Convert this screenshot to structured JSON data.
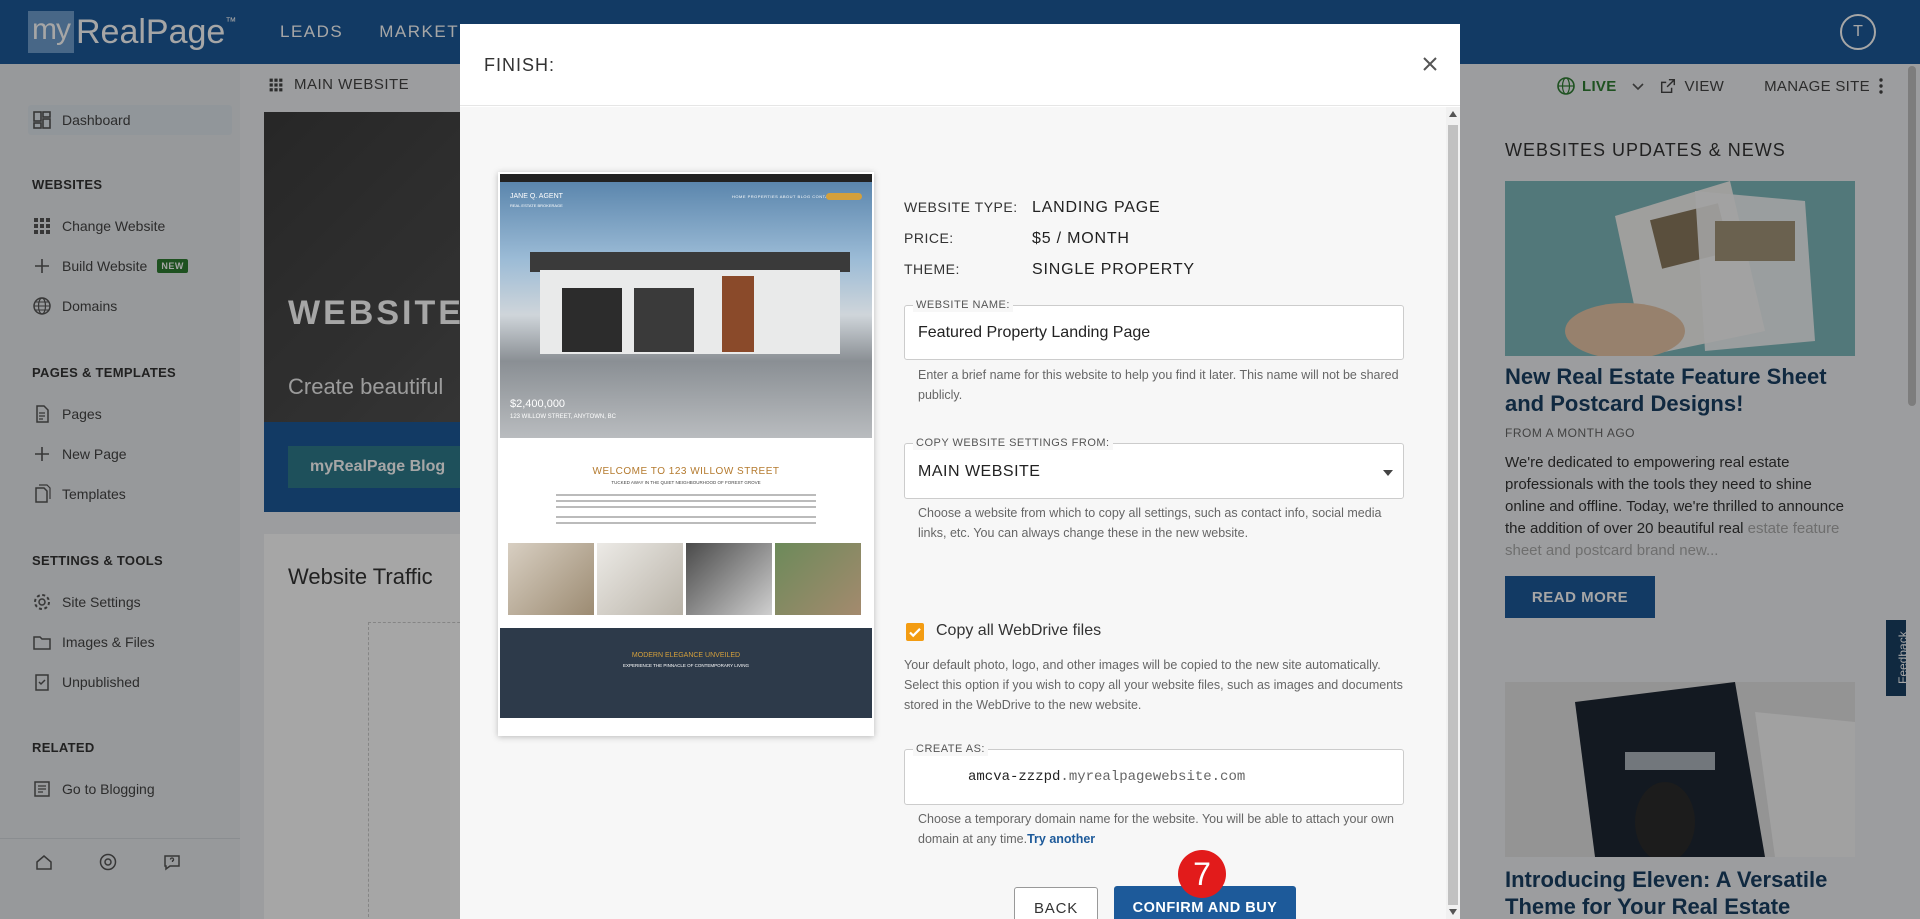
{
  "app": {
    "logo_my": "my",
    "logo_rest": "RealPage",
    "logo_tm": "™",
    "nav": [
      "LEADS",
      "MARKETING"
    ],
    "avatar_initial": "T"
  },
  "sidebar": {
    "dashboard": "Dashboard",
    "sections": {
      "websites": "WEBSITES",
      "pages": "PAGES & TEMPLATES",
      "settings": "SETTINGS & TOOLS",
      "related": "RELATED"
    },
    "items": {
      "change_website": "Change Website",
      "build_website": "Build Website",
      "build_badge": "NEW",
      "domains": "Domains",
      "pages": "Pages",
      "new_page": "New Page",
      "templates": "Templates",
      "site_settings": "Site Settings",
      "images_files": "Images & Files",
      "unpublished": "Unpublished",
      "go_blogging": "Go to Blogging"
    }
  },
  "main": {
    "header": "MAIN WEBSITE",
    "hero_title": "WEBSITES",
    "hero_sub": "Create beautiful",
    "hero_btn": "myRealPage Blog",
    "traffic_title": "Website Traffic"
  },
  "right": {
    "live": "LIVE",
    "view": "VIEW",
    "manage": "MANAGE SITE",
    "news_head": "WEBSITES UPDATES & NEWS",
    "news1_title": "New Real Estate Feature Sheet and Postcard Designs!",
    "news1_meta": "FROM A MONTH AGO",
    "news1_text": "We're dedicated to empowering real estate professionals with the tools they need to shine online and offline. Today, we're thrilled to announce the addition of over 20 beautiful real",
    "news1_fade": "estate feature sheet and postcard brand new...",
    "read_more": "READ MORE",
    "news2_title": "Introducing Eleven: A Versatile Theme for Your Real Estate",
    "feedback": "Feedback"
  },
  "modal": {
    "title": "FINISH:",
    "preview": {
      "agent": "JANE Q. AGENT",
      "agent_sub": "REAL ESTATE BROKERAGE",
      "menu": "HOME  PROPERTIES  ABOUT  BLOG  CONTACT",
      "price": "$2,400,000",
      "address": "123 WILLOW STREET, ANYTOWN, BC",
      "welcome": "WELCOME TO 123 WILLOW STREET",
      "tagline": "TUCKED AWAY IN THE QUIET NEIGHBOURHOOD OF FOREST GROVE",
      "dark_title": "MODERN ELEGANCE UNVEILED",
      "dark_sub": "EXPERIENCE THE PINNACLE OF CONTEMPORARY LIVING"
    },
    "website_type_label": "WEBSITE TYPE:",
    "website_type": "LANDING PAGE",
    "price_label": "PRICE:",
    "price": "$5 / MONTH",
    "theme_label": "THEME:",
    "theme": "SINGLE PROPERTY",
    "name_label": "WEBSITE NAME:",
    "name_value": "Featured Property Landing Page",
    "name_help": "Enter a brief name for this website to help you find it later. This name will not be shared publicly.",
    "copy_label": "COPY WEBSITE SETTINGS FROM:",
    "copy_value": "MAIN WEBSITE",
    "copy_help": "Choose a website from which to copy all settings, such as contact info, social media links, etc. You can always change these in the new website.",
    "webdrive_label": "Copy all WebDrive files",
    "webdrive_help": "Your default photo, logo, and other images will be copied to the new site automatically. Select this option if you wish to copy all your website files, such as images and documents stored in the WebDrive to the new website.",
    "create_label": "CREATE AS:",
    "create_sub": "amcva-zzzpd",
    "create_domain": ".myrealpagewebsite.com",
    "create_help": "Choose a temporary domain name for the website. You will be able to attach your own domain at any time.",
    "try_another": "Try another",
    "back": "BACK",
    "confirm": "CONFIRM AND BUY",
    "step": "7"
  }
}
